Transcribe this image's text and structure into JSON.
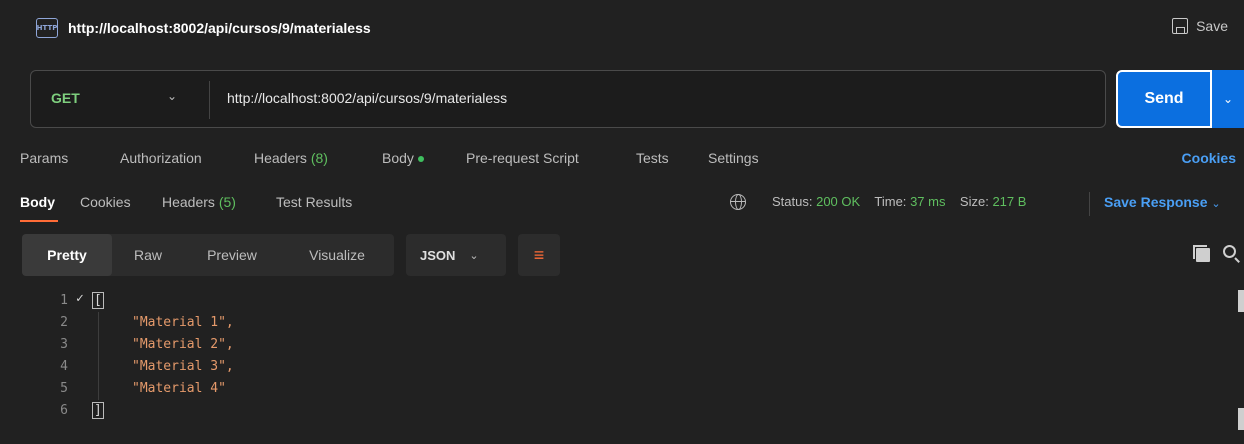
{
  "titlebar": {
    "icon_label": "HTTP",
    "title": "http://localhost:8002/api/cursos/9/materialess",
    "save_label": "Save"
  },
  "request": {
    "method": "GET",
    "url": "http://localhost:8002/api/cursos/9/materialess",
    "send_label": "Send"
  },
  "request_tabs": {
    "params": "Params",
    "authorization": "Authorization",
    "headers": "Headers",
    "headers_count": "(8)",
    "body": "Body",
    "pre_request": "Pre-request Script",
    "tests": "Tests",
    "settings": "Settings",
    "cookies": "Cookies"
  },
  "response_tabs": {
    "body": "Body",
    "cookies": "Cookies",
    "headers": "Headers",
    "headers_count": "(5)",
    "test_results": "Test Results"
  },
  "response_status": {
    "status_label": "Status:",
    "status_value": "200 OK",
    "time_label": "Time:",
    "time_value": "37 ms",
    "size_label": "Size:",
    "size_value": "217 B",
    "save_response": "Save Response"
  },
  "view": {
    "pretty": "Pretty",
    "raw": "Raw",
    "preview": "Preview",
    "visualize": "Visualize",
    "format": "JSON"
  },
  "code": {
    "line_numbers": [
      "1",
      "2",
      "3",
      "4",
      "5",
      "6"
    ],
    "open_bracket": "[",
    "close_bracket": "]",
    "items": [
      "\"Material 1\",",
      "\"Material 2\",",
      "\"Material 3\",",
      "\"Material 4\""
    ]
  },
  "colors": {
    "accent": "#ff6c37",
    "send": "#0b6fe0",
    "link": "#4a9ff5",
    "status_ok": "#5fbf5f",
    "string": "#e59a6b"
  }
}
